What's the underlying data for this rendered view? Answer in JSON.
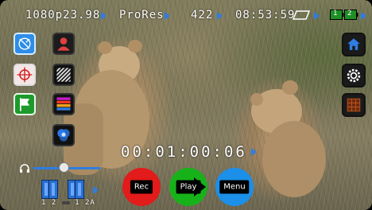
{
  "status_bar": {
    "format": "1080p23.98",
    "codec": "ProRes",
    "codec_profile": "422",
    "record_time": "08:53:59",
    "battery_1": "1",
    "battery_2": "2"
  },
  "timecode": "00:01:00:06",
  "buttons": {
    "rec": "Rec",
    "play": "Play",
    "menu": "Menu"
  },
  "audio": {
    "channels": [
      "1",
      "2",
      "1",
      "2A"
    ],
    "headphone_volume": 0.45
  },
  "colors": {
    "accent": "#2f7de1",
    "rec": "#e21b1b",
    "play": "#17b21a",
    "menu": "#1c8fe8"
  }
}
